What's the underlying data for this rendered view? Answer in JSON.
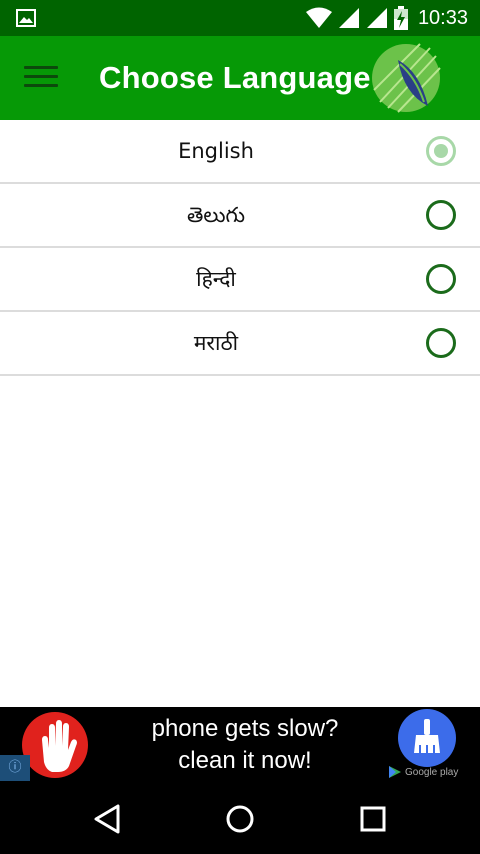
{
  "status_bar": {
    "time": "10:33",
    "icons": [
      "gallery-icon",
      "wifi-icon",
      "signal-icon",
      "signal-icon",
      "battery-charging-icon"
    ]
  },
  "app_bar": {
    "title": "Choose Language",
    "menu_icon": "hamburger-menu-icon",
    "logo": "leaf-logo"
  },
  "languages": [
    {
      "label": "English",
      "selected": true
    },
    {
      "label": "తెలుగు",
      "selected": false
    },
    {
      "label": "हिन्दी",
      "selected": false
    },
    {
      "label": "मराठी",
      "selected": false
    }
  ],
  "ad": {
    "line1": "phone gets slow?",
    "line2": "clean it now!",
    "store_label": "Google play",
    "info_icon": "info-icon",
    "hand_icon": "stop-hand-icon",
    "cleaner_icon": "broom-icon"
  },
  "nav_bar": {
    "buttons": [
      "back-icon",
      "home-icon",
      "recents-icon"
    ]
  },
  "colors": {
    "status_bar": "#006400",
    "app_bar": "#069906",
    "radio_border": "#1b6b1b",
    "radio_selected": "#a8d8a8"
  }
}
